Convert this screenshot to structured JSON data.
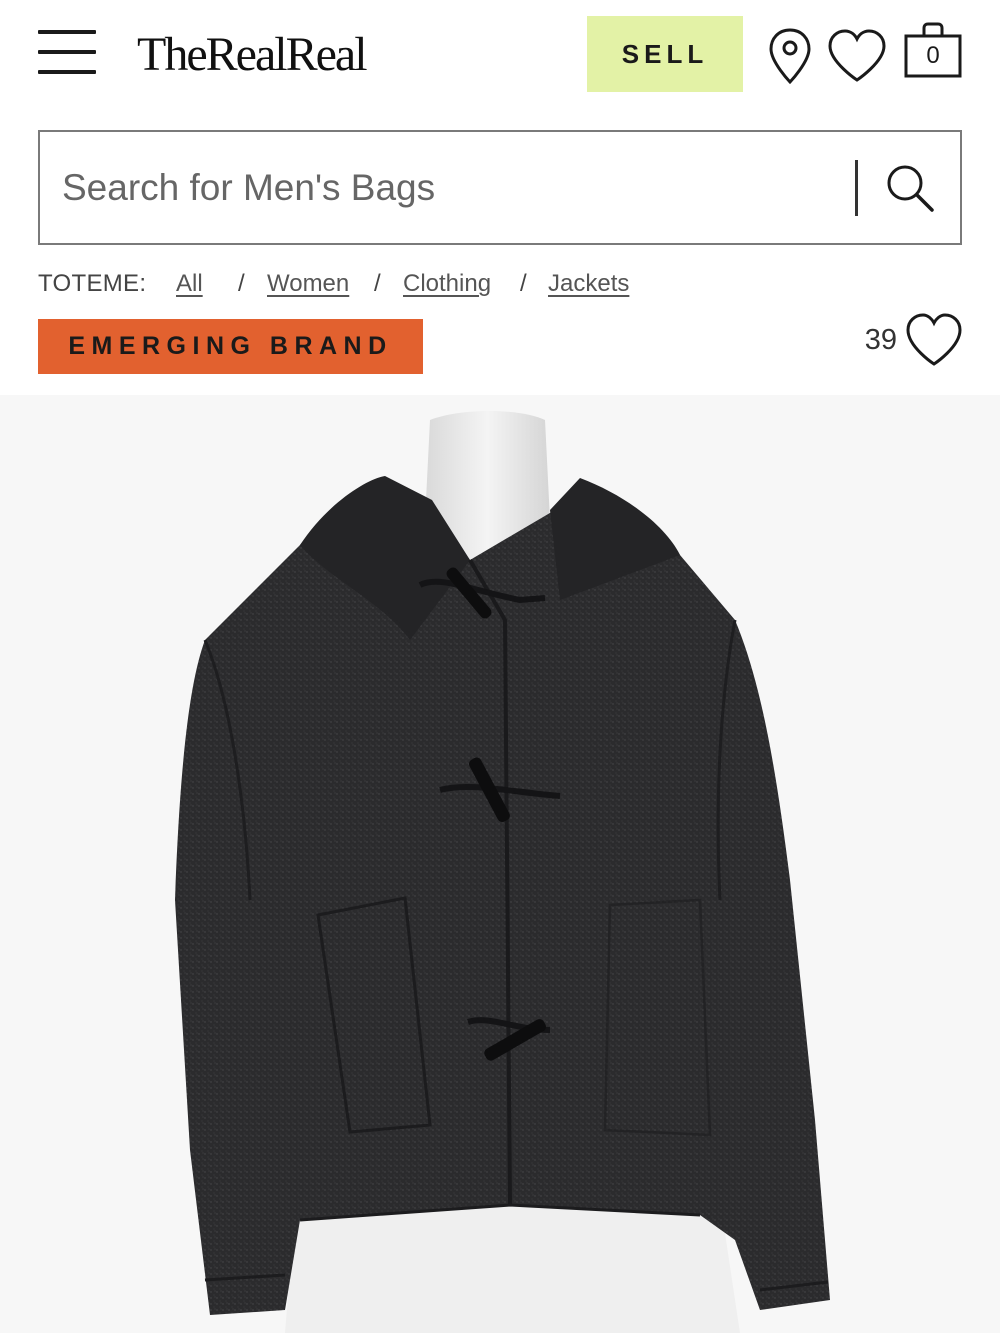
{
  "header": {
    "logo": "TheRealReal",
    "sell_label": "SELL",
    "bag_count": "0",
    "icons": {
      "menu": "hamburger-menu-icon",
      "location": "location-pin-icon",
      "wishlist": "heart-icon",
      "bag": "shopping-bag-icon"
    }
  },
  "search": {
    "placeholder": "Search for Men's Bags",
    "icon": "search-icon"
  },
  "breadcrumb": {
    "brand": "TOTEME:",
    "items": [
      "All",
      "Women",
      "Clothing",
      "Jackets"
    ],
    "separator": "/"
  },
  "product": {
    "badge": "EMERGING BRAND",
    "favorites_count": "39",
    "favorite_icon": "heart-outline-icon",
    "image_alt": "Charcoal wool hooded jacket with toggle closures"
  },
  "colors": {
    "sell_bg": "#e3f2a6",
    "badge_bg": "#e2612f",
    "jacket": "#2b2b2d"
  }
}
